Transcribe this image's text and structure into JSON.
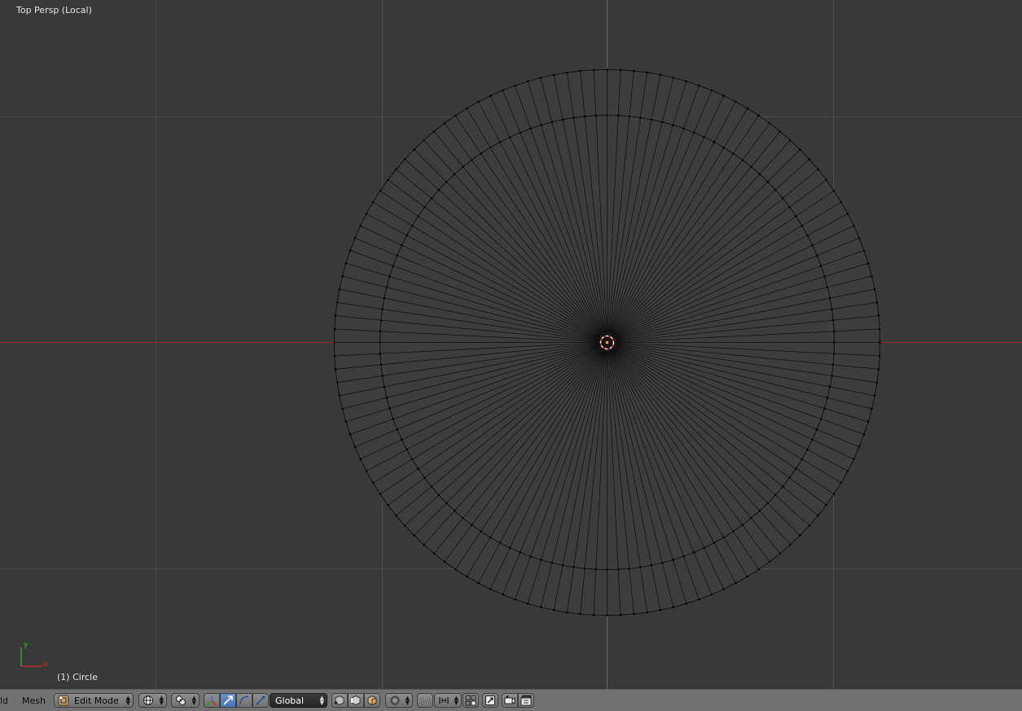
{
  "viewport": {
    "view_name": "Top Persp (Local)",
    "object_name": "(1) Circle",
    "axis_x_label": "x",
    "axis_y_label": "y"
  },
  "header": {
    "menu_add_partial": "ld",
    "menu_mesh": "Mesh",
    "mode_label": "Edit Mode",
    "orientation_label": "Global"
  },
  "colors": {
    "viewport_bg": "#393939",
    "grid_line": "#4d4d4d",
    "x_axis": "#9b2a2a",
    "y_axis": "#2a8c2a",
    "header_bg": "#727272",
    "active_button": "#5680c2"
  },
  "icons": {
    "mode": "edit-mode-icon",
    "viewport_shading": "sphere-shading-icon",
    "pivot": "pivot-point-icon",
    "manipulator": "manipulator-axes-icon",
    "translate": "translate-arrow-icon",
    "rotate": "rotate-arc-icon",
    "scale": "scale-icon",
    "vertex_select": "vertex-select-icon",
    "edge_select": "edge-select-icon",
    "face_select": "face-select-icon",
    "proportional_edit": "proportional-edit-icon",
    "snap": "magnet-icon",
    "snap_element": "snap-element-icon",
    "snap_target": "snap-target-icon",
    "opengl_render": "camera-render-icon",
    "opengl_anim": "clapboard-icon"
  },
  "mesh": {
    "segments": 128,
    "inner_ring_ratio": 0.8326
  }
}
